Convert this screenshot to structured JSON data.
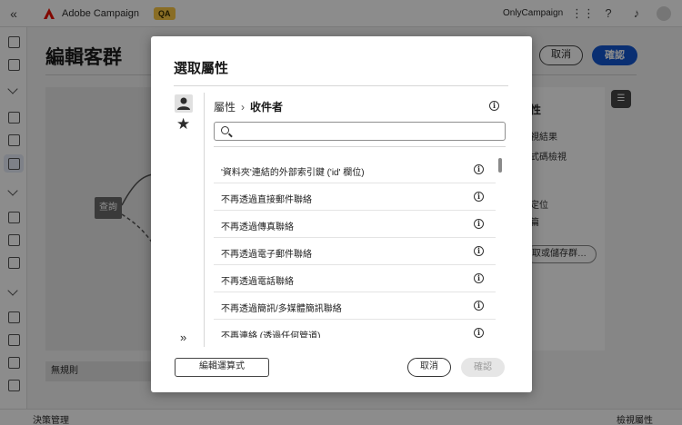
{
  "topbar": {
    "collapse_icon": "double-chevron-left-icon",
    "app_name": "Adobe Campaign",
    "env_badge": "QA",
    "org_name": "OnlyCampaign",
    "icons": [
      "apps-grid-icon",
      "help-icon",
      "bell-icon",
      "avatar-icon"
    ]
  },
  "page": {
    "title": "編輯客群",
    "cancel_label": "取消",
    "confirm_label": "確認",
    "query_node_label": "查詢",
    "no_rule_label": "無規則",
    "right_panel": {
      "title": "性",
      "line1": "視結果",
      "line2": "式碼檢視",
      "line3": "定位",
      "line4": "篇",
      "button_label": "取或儲存群…"
    },
    "bottom_left": "決策管理",
    "bottom_right": "檢視屬性"
  },
  "dialog": {
    "title": "選取屬性",
    "breadcrumb_root": "屬性",
    "breadcrumb_separator": "›",
    "breadcrumb_current": "收件者",
    "search_placeholder": "",
    "items": [
      {
        "label": "'資料夾'連結的外部索引鍵 ('id' 欄位)"
      },
      {
        "label": "不再透過直接郵件聯絡"
      },
      {
        "label": "不再透過傳真聯絡"
      },
      {
        "label": "不再透過電子郵件聯絡"
      },
      {
        "label": "不再透過電話聯絡"
      },
      {
        "label": "不再透過簡訊/多媒體簡訊聯絡"
      },
      {
        "label": "不再連絡 (透過任何管道)"
      }
    ],
    "edit_expression_label": "編輯運算式",
    "cancel_label": "取消",
    "confirm_label": "確認",
    "confirm_disabled": true
  },
  "colors": {
    "accent": "#1357cf",
    "badge": "#f9c744",
    "overlay": "rgba(0,0,0,0.45)"
  }
}
